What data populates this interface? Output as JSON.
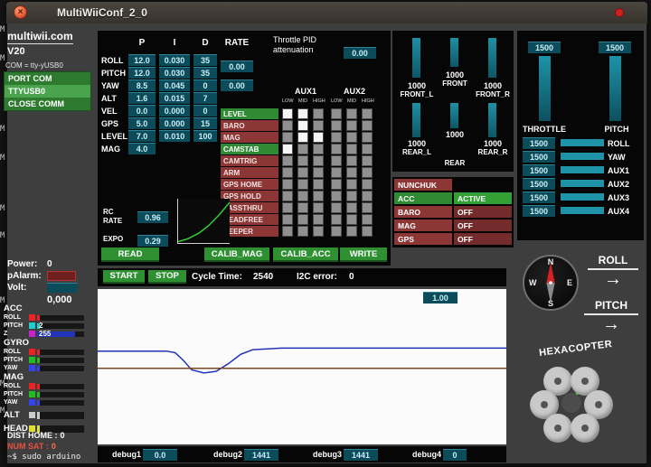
{
  "desktop": {
    "edge_char": "M",
    "terminal_text": "~$ sudo arduino"
  },
  "window": {
    "title": "MultiWiiConf_2_0",
    "close_glyph": "×"
  },
  "left": {
    "site": "multiwii.com",
    "version": "V20",
    "com": "COM = tty-yUSB0",
    "port": {
      "port_button": "PORT COM",
      "device": "TTYUSB0",
      "close_button": "CLOSE COMM"
    },
    "power_label": "Power:",
    "power_value": "0",
    "palarm_label": "pAlarm:",
    "palarm_value": "",
    "volt_label": "Volt:",
    "volt_value": "",
    "volt_reading": "0,000",
    "sensor_groups": [
      {
        "name": "ACC",
        "axes": [
          {
            "label": "ROLL",
            "color": "#ee2222",
            "value": "",
            "fill": 0.06
          },
          {
            "label": "PITCH",
            "color": "#22cccc",
            "value": "2",
            "fill": 0.06
          },
          {
            "label": "Z",
            "color": "#cc22cc",
            "value": "255",
            "fill": 0.8,
            "fill_color": "#2233bb"
          }
        ]
      },
      {
        "name": "GYRO",
        "axes": [
          {
            "label": "ROLL",
            "color": "#ee2222",
            "value": "",
            "fill": 0.06
          },
          {
            "label": "PITCH",
            "color": "#22bb22",
            "value": "",
            "fill": 0.06
          },
          {
            "label": "YAW",
            "color": "#3344ee",
            "value": "",
            "fill": 0.06
          }
        ]
      },
      {
        "name": "MAG",
        "axes": [
          {
            "label": "ROLL",
            "color": "#ee2222",
            "value": "",
            "fill": 0.06
          },
          {
            "label": "PITCH",
            "color": "#22bb22",
            "value": "",
            "fill": 0.06
          },
          {
            "label": "YAW",
            "color": "#3344ee",
            "value": "",
            "fill": 0.06
          }
        ]
      },
      {
        "name": "ALT",
        "axes": [
          {
            "label": "",
            "color": "#cccccc",
            "value": "",
            "fill": 0.06
          }
        ]
      },
      {
        "name": "HEAD",
        "axes": [
          {
            "label": "",
            "color": "#dddd33",
            "value": "",
            "fill": 0.06
          }
        ]
      }
    ],
    "dist_home_label": "DIST HOME :",
    "dist_home_value": "0",
    "num_sat_label": "NUM SAT :",
    "num_sat_value": "0"
  },
  "pid": {
    "headers": [
      "P",
      "I",
      "D",
      "RATE"
    ],
    "rows": [
      {
        "label": "ROLL",
        "p": "12.0",
        "i": "0.030",
        "d": "35"
      },
      {
        "label": "PITCH",
        "p": "12.0",
        "i": "0.030",
        "d": "35"
      },
      {
        "label": "YAW",
        "p": "8.5",
        "i": "0.045",
        "d": "0"
      },
      {
        "label": "ALT",
        "p": "1.6",
        "i": "0.015",
        "d": "7"
      },
      {
        "label": "VEL",
        "p": "0.0",
        "i": "0.000",
        "d": "0"
      },
      {
        "label": "GPS",
        "p": "5.0",
        "i": "0.000",
        "d": "15"
      },
      {
        "label": "LEVEL",
        "p": "7.0",
        "i": "0.010",
        "d": "100"
      },
      {
        "label": "MAG",
        "p": "4.0",
        "i": "",
        "d": ""
      }
    ],
    "rate_rollpitch": "0.00",
    "rate_yaw": "0.00",
    "tpa_label": "Throttle PID attenuation",
    "tpa_value": "0.00",
    "rc_rate_label": "RC RATE",
    "rc_rate_value": "0.96",
    "expo_label": "EXPO",
    "expo_value": "0.29"
  },
  "aux": {
    "groups": [
      "AUX1",
      "AUX2"
    ],
    "level_headers": [
      "LOW",
      "MID",
      "HIGH"
    ],
    "rows": [
      {
        "label": "LEVEL",
        "active": true,
        "cells": [
          1,
          1,
          0,
          0,
          0,
          0
        ]
      },
      {
        "label": "BARO",
        "active": false,
        "cells": [
          0,
          1,
          0,
          0,
          0,
          0
        ]
      },
      {
        "label": "MAG",
        "active": false,
        "cells": [
          0,
          1,
          1,
          0,
          0,
          0
        ]
      },
      {
        "label": "CAMSTAB",
        "active": true,
        "cells": [
          1,
          0,
          0,
          0,
          0,
          0
        ]
      },
      {
        "label": "CAMTRIG",
        "active": false,
        "cells": [
          0,
          0,
          0,
          0,
          0,
          0
        ]
      },
      {
        "label": "ARM",
        "active": false,
        "cells": [
          0,
          0,
          0,
          0,
          0,
          0
        ]
      },
      {
        "label": "GPS HOME",
        "active": false,
        "cells": [
          0,
          0,
          0,
          0,
          0,
          0
        ]
      },
      {
        "label": "GPS HOLD",
        "active": false,
        "cells": [
          0,
          0,
          0,
          0,
          0,
          0
        ]
      },
      {
        "label": "PASSTHRU",
        "active": false,
        "cells": [
          0,
          0,
          0,
          0,
          0,
          0
        ]
      },
      {
        "label": "HEADFREE",
        "active": false,
        "cells": [
          0,
          0,
          0,
          0,
          0,
          0
        ]
      },
      {
        "label": "BEEPER",
        "active": false,
        "cells": [
          0,
          0,
          0,
          0,
          0,
          0
        ]
      }
    ]
  },
  "actions": {
    "read": "READ",
    "calib_mag": "CALIB_MAG",
    "calib_acc": "CALIB_ACC",
    "write": "WRITE"
  },
  "motors": {
    "front": [
      {
        "name": "FRONT_L",
        "value": "1000"
      },
      {
        "name": "FRONT",
        "value": "1000"
      },
      {
        "name": "FRONT_R",
        "value": "1000"
      }
    ],
    "rear": [
      {
        "name": "REAR_L",
        "value": "1000"
      },
      {
        "name": "REAR",
        "value": "1000"
      },
      {
        "name": "REAR_R",
        "value": "1000"
      }
    ]
  },
  "status": {
    "rows": [
      {
        "name": "NUNCHUK",
        "state": "",
        "name_on": false,
        "state_on": false
      },
      {
        "name": "ACC",
        "state": "ACTIVE",
        "name_on": true,
        "state_on": true
      },
      {
        "name": "BARO",
        "state": "OFF",
        "name_on": false,
        "state_on": false
      },
      {
        "name": "MAG",
        "state": "OFF",
        "name_on": false,
        "state_on": false
      },
      {
        "name": "GPS",
        "state": "OFF",
        "name_on": false,
        "state_on": false
      }
    ]
  },
  "rc": {
    "throttle": {
      "label": "THROTTLE",
      "value": "1500"
    },
    "pitch": {
      "label": "PITCH",
      "value": "1500"
    },
    "channels": [
      {
        "label": "ROLL",
        "value": "1500"
      },
      {
        "label": "YAW",
        "value": "1500"
      },
      {
        "label": "AUX1",
        "value": "1500"
      },
      {
        "label": "AUX2",
        "value": "1500"
      },
      {
        "label": "AUX3",
        "value": "1500"
      },
      {
        "label": "AUX4",
        "value": "1500"
      }
    ]
  },
  "monitor": {
    "start": "START",
    "stop": "STOP",
    "cycle_label": "Cycle Time:",
    "cycle_value": "2540",
    "i2c_label": "I2C error:",
    "i2c_value": "0",
    "scale_value": "1.00"
  },
  "debug": [
    {
      "label": "debug1",
      "value": "0.0"
    },
    {
      "label": "debug2",
      "value": "1441"
    },
    {
      "label": "debug3",
      "value": "1441"
    },
    {
      "label": "debug4",
      "value": "0"
    }
  ],
  "widgets": {
    "compass_letters": [
      "N",
      "W",
      "E",
      "S"
    ],
    "roll_label": "ROLL",
    "pitch_label": "PITCH",
    "arrow_glyph": "→",
    "model_label": "HEXACOPTER"
  },
  "chart_data": [
    {
      "type": "line",
      "x_range": [
        0,
        100
      ],
      "y_range": [
        0,
        100
      ],
      "grid": false,
      "legend": "none",
      "series": [
        {
          "name": "sensor-trace-blue",
          "color": "#2233bb",
          "points": [
            [
              0,
              40
            ],
            [
              17,
              40
            ],
            [
              19,
              41
            ],
            [
              21,
              46
            ],
            [
              23,
              52
            ],
            [
              26,
              54
            ],
            [
              29,
              53
            ],
            [
              32,
              48
            ],
            [
              35,
              42
            ],
            [
              38,
              39
            ],
            [
              45,
              38
            ],
            [
              100,
              38
            ]
          ]
        },
        {
          "name": "sensor-trace-brown",
          "color": "#7a4520",
          "points": [
            [
              0,
              51
            ],
            [
              100,
              51
            ]
          ]
        }
      ]
    },
    {
      "type": "line",
      "x_range": [
        0,
        100
      ],
      "y_range": [
        0,
        100
      ],
      "series": [
        {
          "name": "rc-expo-curve",
          "color": "#33cc33",
          "points": [
            [
              0,
              97
            ],
            [
              20,
              90
            ],
            [
              40,
              78
            ],
            [
              60,
              60
            ],
            [
              80,
              36
            ],
            [
              100,
              8
            ]
          ]
        }
      ]
    }
  ]
}
